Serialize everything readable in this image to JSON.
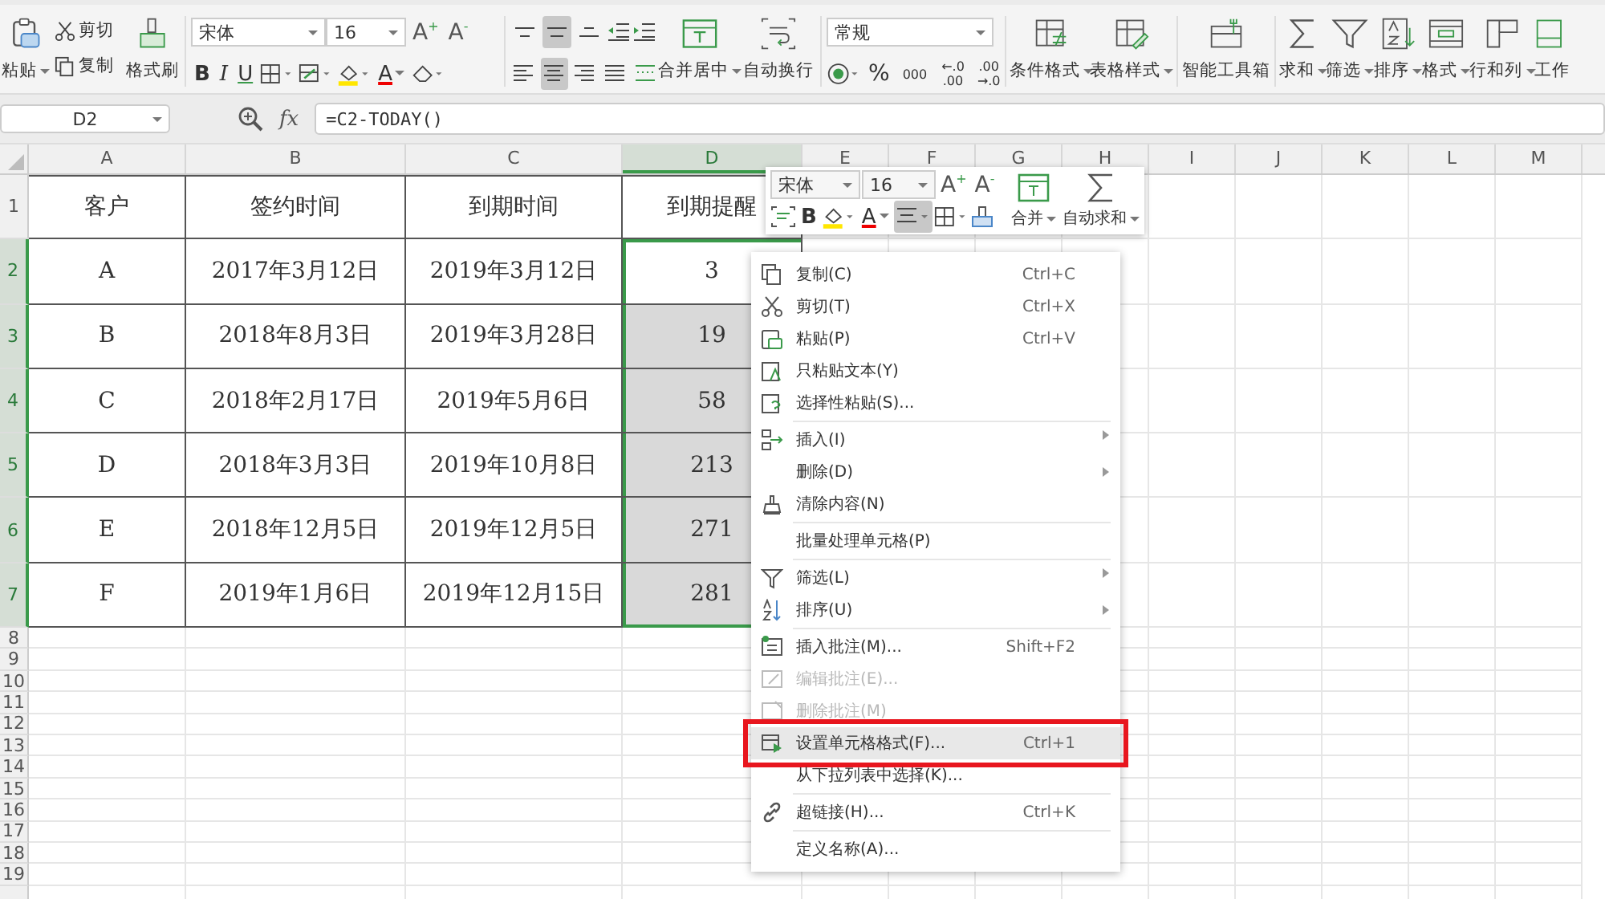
{
  "ribbon": {
    "clipboard": {
      "paste": "粘贴",
      "cut": "剪切",
      "copy": "复制",
      "format_painter": "格式刷"
    },
    "font": {
      "name": "宋体",
      "size": "16",
      "grow": "A$^{+}$",
      "shrink": "A$^{-}$",
      "bold": "B",
      "italic": "I",
      "underline": "U",
      "font_color": "A"
    },
    "vertical_align": [
      {
        "selected": false
      },
      {
        "selected": true
      },
      {
        "selected": false
      }
    ],
    "horizontal_align": [
      {
        "selected": false
      },
      {
        "selected": true
      },
      {
        "selected": false
      },
      {
        "selected": false
      },
      {
        "selected": false
      }
    ],
    "wide_buttons": [
      {
        "label": "合并居中",
        "dropdown": true
      },
      {
        "label": "自动换行",
        "dropdown": false
      }
    ],
    "number": {
      "format": "常规",
      "percent": "%",
      "thousands": "000",
      "decimal_increase": [
        "←.0",
        ".00"
      ],
      "decimal_decrease": [
        ".00",
        "→.0"
      ]
    },
    "tool_buttons": [
      {
        "label": "条件格式",
        "dropdown": true
      },
      {
        "label": "表格样式",
        "dropdown": true
      },
      {
        "label": "智能工具箱",
        "dropdown": false
      },
      {
        "label": "求和",
        "dropdown": true
      },
      {
        "label": "筛选",
        "dropdown": true
      },
      {
        "label": "排序",
        "dropdown": true
      },
      {
        "label": "格式",
        "dropdown": true
      },
      {
        "label": "行和列",
        "dropdown": true
      },
      {
        "label": "工作",
        "dropdown": false
      }
    ]
  },
  "formula_bar": {
    "name_box": "D2",
    "fx": "fx",
    "formula": "=C2-TODAY()"
  },
  "columns": [
    {
      "label": "A",
      "selected": false
    },
    {
      "label": "B",
      "selected": false
    },
    {
      "label": "C",
      "selected": false
    },
    {
      "label": "D",
      "selected": true
    },
    {
      "label": "E",
      "selected": false
    },
    {
      "label": "F",
      "selected": false
    },
    {
      "label": "G",
      "selected": false
    },
    {
      "label": "H",
      "selected": false
    },
    {
      "label": "I",
      "selected": false
    },
    {
      "label": "J",
      "selected": false
    },
    {
      "label": "K",
      "selected": false
    },
    {
      "label": "L",
      "selected": false
    },
    {
      "label": "M",
      "selected": false
    }
  ],
  "rows": [
    {
      "number": "1",
      "selected": false,
      "cells": [
        "客户",
        "签约时间",
        "到期时间",
        "到期提醒"
      ]
    },
    {
      "number": "2",
      "selected": true,
      "cells": [
        "A",
        "2017年3月12日",
        "2019年3月12日",
        "3"
      ]
    },
    {
      "number": "3",
      "selected": true,
      "cells": [
        "B",
        "2018年8月3日",
        "2019年3月28日",
        "19"
      ]
    },
    {
      "number": "4",
      "selected": true,
      "cells": [
        "C",
        "2018年2月17日",
        "2019年5月6日",
        "58"
      ]
    },
    {
      "number": "5",
      "selected": true,
      "cells": [
        "D",
        "2018年3月3日",
        "2019年10月8日",
        "213"
      ]
    },
    {
      "number": "6",
      "selected": true,
      "cells": [
        "E",
        "2018年12月5日",
        "2019年12月5日",
        "271"
      ]
    },
    {
      "number": "7",
      "selected": true,
      "cells": [
        "F",
        "2019年1月6日",
        "2019年12月15日",
        "281"
      ]
    }
  ],
  "empty_rows": [
    "8",
    "9",
    "10",
    "11",
    "12",
    "13",
    "14",
    "15",
    "16",
    "17",
    "18",
    "19"
  ],
  "mini_toolbar": {
    "font": "宋体",
    "size": "16",
    "grow": "A$^{+}$",
    "shrink": "A$^{-}$",
    "bold": "B",
    "font_color": "A",
    "align_selected": true,
    "buttons": [
      {
        "label": "合并",
        "dropdown": true
      },
      {
        "label": "自动求和",
        "dropdown": true
      }
    ]
  },
  "context_menu": [
    {
      "label": "复制(C)",
      "shortcut": "Ctrl+C",
      "disabled": false,
      "submenu": false,
      "highlighted": false,
      "outlined": false,
      "separator_before": false
    },
    {
      "label": "剪切(T)",
      "shortcut": "Ctrl+X",
      "disabled": false,
      "submenu": false,
      "highlighted": false,
      "outlined": false,
      "separator_before": false
    },
    {
      "label": "粘贴(P)",
      "shortcut": "Ctrl+V",
      "disabled": false,
      "submenu": false,
      "highlighted": false,
      "outlined": false,
      "separator_before": false
    },
    {
      "label": "只粘贴文本(Y)",
      "disabled": false,
      "submenu": false,
      "highlighted": false,
      "outlined": false,
      "separator_before": false
    },
    {
      "label": "选择性粘贴(S)...",
      "disabled": false,
      "submenu": false,
      "highlighted": false,
      "outlined": false,
      "separator_before": false
    },
    {
      "label": "插入(I)",
      "disabled": false,
      "submenu": true,
      "highlighted": false,
      "outlined": false,
      "separator_before": true
    },
    {
      "label": "删除(D)",
      "disabled": false,
      "submenu": true,
      "highlighted": false,
      "outlined": false,
      "separator_before": false
    },
    {
      "label": "清除内容(N)",
      "disabled": false,
      "submenu": false,
      "highlighted": false,
      "outlined": false,
      "separator_before": false
    },
    {
      "label": "批量处理单元格(P)",
      "disabled": false,
      "submenu": false,
      "highlighted": false,
      "outlined": false,
      "separator_before": true
    },
    {
      "label": "筛选(L)",
      "disabled": false,
      "submenu": true,
      "highlighted": false,
      "outlined": false,
      "separator_before": true
    },
    {
      "label": "排序(U)",
      "disabled": false,
      "submenu": true,
      "highlighted": false,
      "outlined": false,
      "separator_before": false
    },
    {
      "label": "插入批注(M)...",
      "shortcut": "Shift+F2",
      "disabled": false,
      "submenu": false,
      "highlighted": false,
      "outlined": false,
      "separator_before": true
    },
    {
      "label": "编辑批注(E)...",
      "disabled": true,
      "submenu": false,
      "highlighted": false,
      "outlined": false,
      "separator_before": false
    },
    {
      "label": "删除批注(M)",
      "disabled": true,
      "submenu": false,
      "highlighted": false,
      "outlined": false,
      "separator_before": false
    },
    {
      "label": "设置单元格格式(F)...",
      "shortcut": "Ctrl+1",
      "disabled": false,
      "submenu": false,
      "highlighted": true,
      "outlined": true,
      "separator_before": false
    },
    {
      "label": "从下拉列表中选择(K)...",
      "disabled": false,
      "submenu": false,
      "highlighted": false,
      "outlined": false,
      "separator_before": false
    },
    {
      "label": "超链接(H)...",
      "shortcut": "Ctrl+K",
      "disabled": false,
      "submenu": false,
      "highlighted": false,
      "outlined": false,
      "separator_before": true
    },
    {
      "label": "定义名称(A)...",
      "disabled": false,
      "submenu": false,
      "highlighted": false,
      "outlined": false,
      "separator_before": true
    }
  ]
}
